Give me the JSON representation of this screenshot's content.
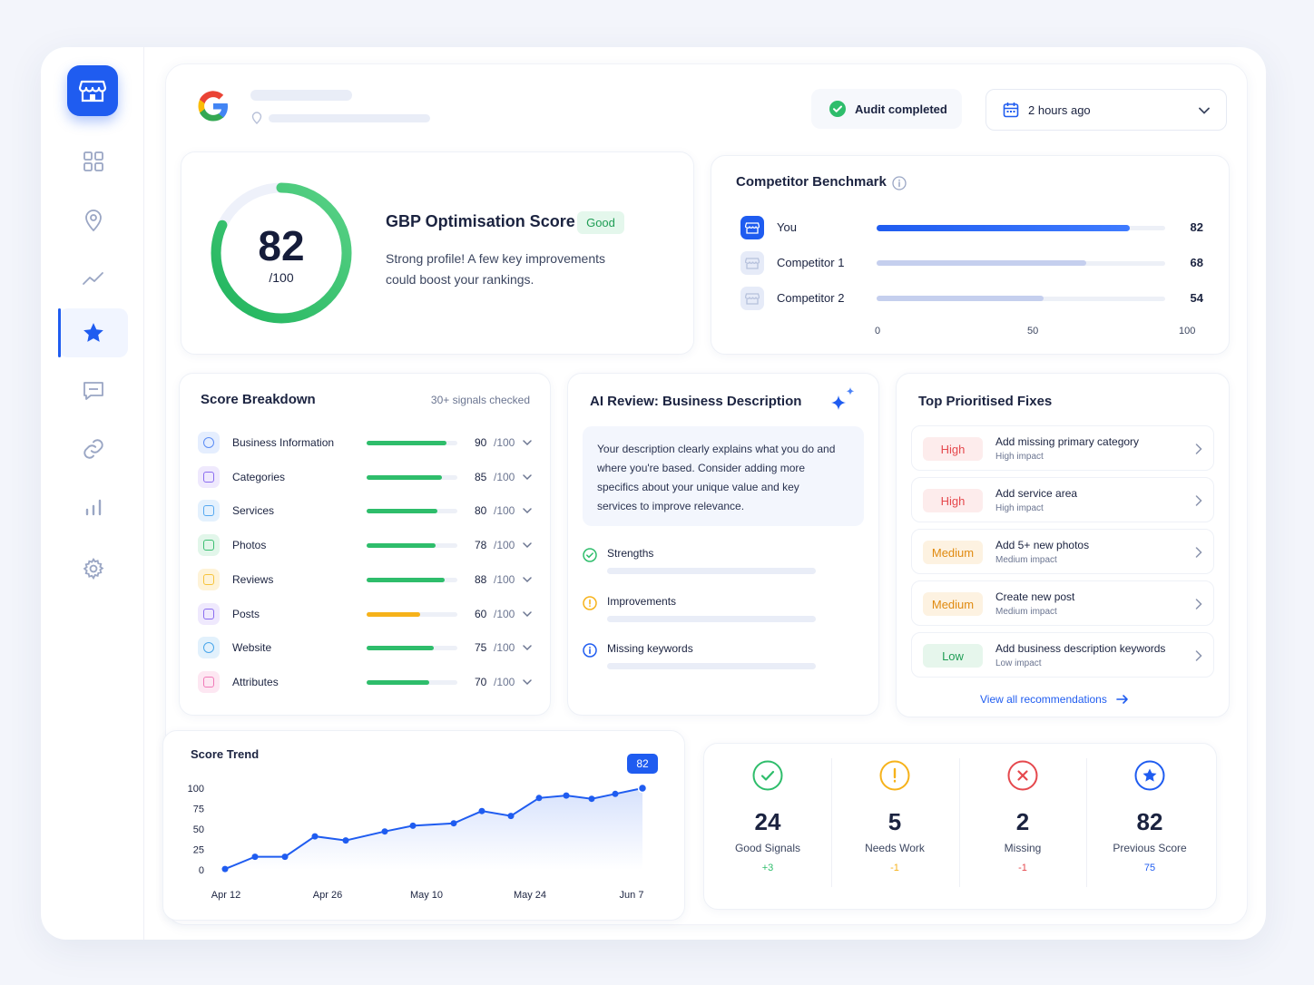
{
  "header": {
    "status_label": "Audit completed",
    "time_label": "2 hours ago"
  },
  "score_card": {
    "score": "82",
    "out_of": "/100",
    "score_value": 82,
    "title": "GBP Optimisation Score",
    "badge": "Good",
    "description_line1": "Strong profile! A few key improvements",
    "description_line2": "could boost your rankings."
  },
  "benchmark": {
    "title": "Competitor Benchmark",
    "rows": [
      {
        "label": "You",
        "value": "82",
        "fraction": 0.82
      },
      {
        "label": "Competitor 1",
        "value": "68",
        "fraction": 0.68
      },
      {
        "label": "Competitor 2",
        "value": "54",
        "fraction": 0.54
      }
    ],
    "axis": [
      "0",
      "50",
      "100"
    ]
  },
  "breakdown": {
    "title": "Score Breakdown",
    "subtitle": "30+ signals checked",
    "rows": [
      {
        "label": "Business Information",
        "score": "90",
        "unit": "/100",
        "fraction": 0.9,
        "color": "#2ebd6b",
        "icon": "info-icon"
      },
      {
        "label": "Categories",
        "score": "85",
        "unit": "/100",
        "fraction": 0.85,
        "color": "#2ebd6b",
        "icon": "category-icon"
      },
      {
        "label": "Services",
        "score": "80",
        "unit": "/100",
        "fraction": 0.8,
        "color": "#2ebd6b",
        "icon": "services-icon"
      },
      {
        "label": "Photos",
        "score": "78",
        "unit": "/100",
        "fraction": 0.78,
        "color": "#2ebd6b",
        "icon": "photo-icon"
      },
      {
        "label": "Reviews",
        "score": "88",
        "unit": "/100",
        "fraction": 0.88,
        "color": "#2ebd6b",
        "icon": "review-star-icon"
      },
      {
        "label": "Posts",
        "score": "60",
        "unit": "/100",
        "fraction": 0.6,
        "color": "#f6b21a",
        "icon": "posts-icon"
      },
      {
        "label": "Website",
        "score": "75",
        "unit": "/100",
        "fraction": 0.75,
        "color": "#2ebd6b",
        "icon": "globe-icon"
      },
      {
        "label": "Attributes",
        "score": "70",
        "unit": "/100",
        "fraction": 0.7,
        "color": "#2ebd6b",
        "icon": "tag-icon"
      }
    ]
  },
  "ai_review": {
    "title": "AI Review: Business Description",
    "body_line1": "Your description clearly explains what you do and",
    "body_line2": "where you're based. Consider adding more",
    "body_line3": "specifics about your unique value and key",
    "body_line4": "services to improve relevance.",
    "items": [
      {
        "label": "Strengths",
        "icon": "check-circle-icon"
      },
      {
        "label": "Improvements",
        "icon": "warning-circle-icon"
      },
      {
        "label": "Missing keywords",
        "icon": "info-circle-icon"
      }
    ]
  },
  "fixes": {
    "title": "Top Prioritised Fixes",
    "items": [
      {
        "priority": "High",
        "title": "Add missing primary category",
        "impact": "High impact"
      },
      {
        "priority": "High",
        "title": "Add service area",
        "impact": "High impact"
      },
      {
        "priority": "Medium",
        "title": "Add 5+ new photos",
        "impact": "Medium impact"
      },
      {
        "priority": "Medium",
        "title": "Create new post",
        "impact": "Medium impact"
      },
      {
        "priority": "Low",
        "title": "Add business description keywords",
        "impact": "Low impact"
      }
    ],
    "view_all": "View all recommendations",
    "colors": {
      "High": "#e5484d",
      "Medium": "#e08a10",
      "Low": "#1f9d55"
    }
  },
  "chart_data": {
    "type": "line",
    "title": "Score Trend",
    "ylim": [
      0,
      100
    ],
    "yticks": [
      "100",
      "75",
      "50",
      "25",
      "0"
    ],
    "xticks": [
      "Apr 12",
      "Apr 26",
      "May 10",
      "May 24",
      "Jun 7"
    ],
    "series": [
      {
        "values": [
          1,
          16,
          16,
          41,
          36,
          47,
          54,
          57,
          72,
          66,
          88,
          91,
          87,
          93,
          100
        ]
      }
    ],
    "end_label": "82"
  },
  "stats": [
    {
      "value": "24",
      "label": "Good Signals",
      "delta": "+3",
      "icon": "check-circle-icon",
      "color": "#2ebd6b"
    },
    {
      "value": "5",
      "label": "Needs Work",
      "delta": "-1",
      "icon": "exclamation-circle-icon",
      "color": "#f6b21a"
    },
    {
      "value": "2",
      "label": "Missing",
      "delta": "-1",
      "icon": "x-circle-icon",
      "color": "#e5484d"
    },
    {
      "value": "82",
      "label": "Previous Score",
      "delta": "75",
      "icon": "star-circle-icon",
      "color": "#1f5cf0"
    }
  ]
}
